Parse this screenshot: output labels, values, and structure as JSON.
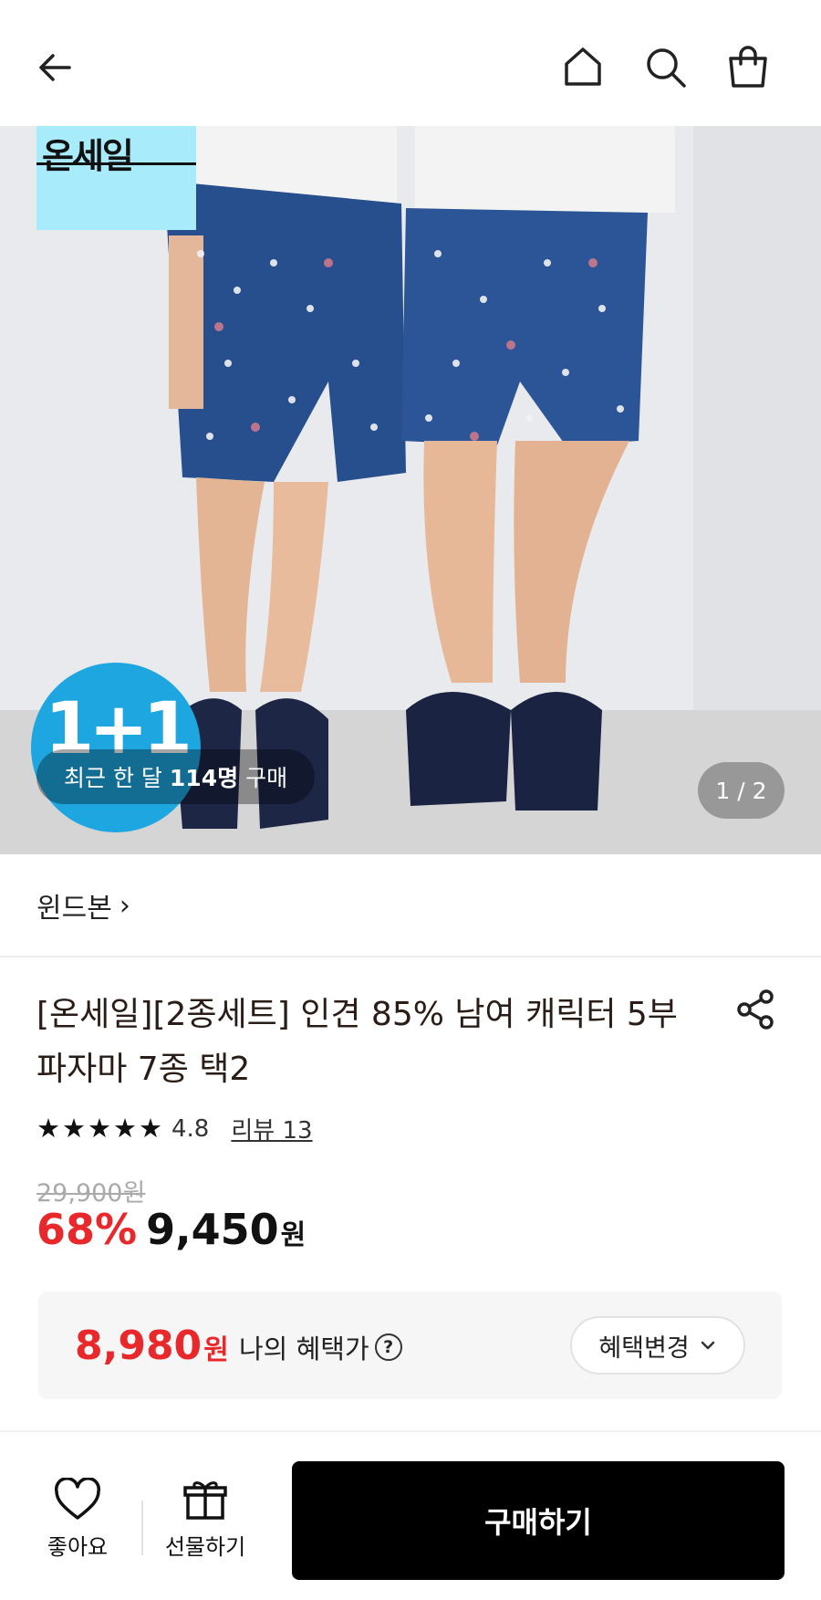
{
  "header": {
    "back_icon": "arrow-left-icon",
    "home_icon": "home-icon",
    "search_icon": "search-icon",
    "cart_icon": "shopping-bag-icon"
  },
  "hero": {
    "onsale_badge": "온세일",
    "promo_badge": "1+1",
    "recent_purchases_prefix": "최근 한 달",
    "recent_purchases_count": "114명",
    "recent_purchases_suffix": "구매",
    "page_indicator": "1 / 2"
  },
  "product": {
    "brand": "윈드본",
    "brand_chevron": "›",
    "title": "[온세일][2종세트] 인견 85% 남여 캐릭터 5부 파자마 7종 택2",
    "share_icon": "share-icon",
    "rating": {
      "stars": 5,
      "score": "4.8",
      "review_label": "리뷰 13"
    },
    "original_price": "29,900원",
    "discount_rate": "68%",
    "price": "9,450",
    "currency": "원"
  },
  "benefit": {
    "price": "8,980",
    "currency": "원",
    "label": "나의 혜택가",
    "help_icon": "question-circle-icon",
    "change_label": "혜택변경",
    "change_chevron": "⌄"
  },
  "bottom_bar": {
    "like_label": "좋아요",
    "gift_label": "선물하기",
    "buy_label": "구매하기"
  },
  "colors": {
    "discount_red": "#e8282b",
    "buy_button": "#000000",
    "onsale_badge_bg": "#a8ecfb",
    "promo_badge_bg": "#1ea6e0"
  }
}
